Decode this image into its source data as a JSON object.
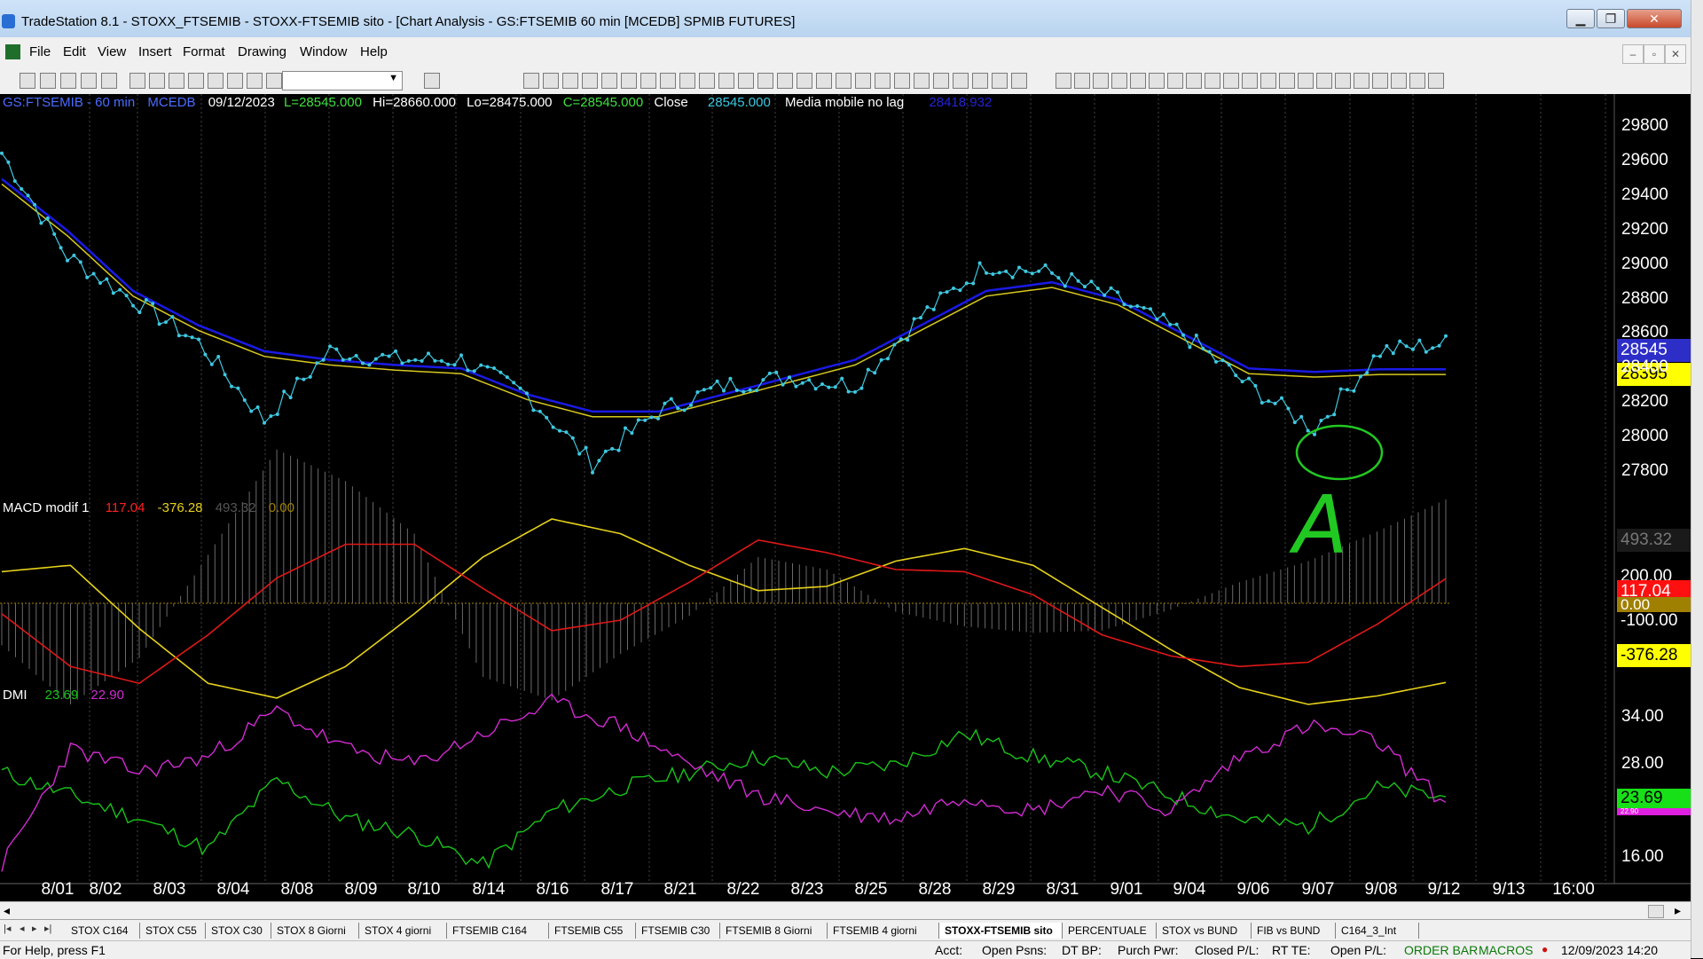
{
  "window": {
    "title": "TradeStation 8.1 - STOXX_FTSEMIB - STOXX-FTSEMIB sito - [Chart Analysis - GS:FTSEMIB  60 min  [MCEDB] SPMIB FUTURES]",
    "min_icon": "minimize-icon",
    "max_icon": "maximize-icon",
    "close_icon": "close-icon",
    "min_glyph": "▁",
    "max_glyph": "❐",
    "close_glyph": "✕"
  },
  "menu": [
    "File",
    "Edit",
    "View",
    "Insert",
    "Format",
    "Drawing",
    "Window",
    "Help"
  ],
  "mdi": {
    "min": "–",
    "restore": "▫",
    "close": "✕"
  },
  "toolbar": {
    "combo_value": ""
  },
  "chart": {
    "symbol": "GS:FTSEMIB - 60 min",
    "source": "MCEDB",
    "date": "09/12/2023",
    "last": "L=28545.000",
    "high": "Hi=28660.000",
    "low": "Lo=28475.000",
    "close_c": "C=28545.000",
    "close_label": "Close",
    "close_value": "28545.000",
    "ma_label": "Media mobile no lag",
    "ma_value": "28418.932",
    "price_tag_last": "28545",
    "price_tag_ma": "28395",
    "annotation_letter": "A",
    "macd": {
      "name": "MACD modif 1",
      "v1": "117.04",
      "v2": "-376.28",
      "v3": "493.32",
      "v4": "0.00",
      "tag1": "493.32",
      "tag2": "117.04",
      "tag3": "0.00",
      "tag4": "-376.28",
      "tag5": "200.00",
      "tag6": "-100.00"
    },
    "dmi": {
      "name": "DMI",
      "v1": "23.69",
      "v2": "22.90",
      "tag1": "23.69",
      "tag2": "22.90"
    }
  },
  "colors": {
    "price_dots": "#3ec8e0",
    "ma_blue": "#1a1ae6",
    "ma_yellow": "#d6c81e",
    "macd_red": "#e01818",
    "macd_yellow": "#e6d21a",
    "dmi_green": "#18c418",
    "dmi_magenta": "#d22ad2",
    "annotation": "#22c822"
  },
  "chart_data": [
    {
      "type": "line",
      "title": "GS:FTSEMIB - 60 min",
      "x": [
        "8/01",
        "8/02",
        "8/03",
        "8/04",
        "8/08",
        "8/09",
        "8/10",
        "8/14",
        "8/16",
        "8/17",
        "8/21",
        "8/22",
        "8/23",
        "8/25",
        "8/28",
        "8/29",
        "8/31",
        "9/01",
        "9/04",
        "9/06",
        "9/07",
        "9/08",
        "9/12",
        "9/13",
        "16:00"
      ],
      "yticks": [
        27800,
        28000,
        28200,
        28400,
        28600,
        28800,
        29000,
        29200,
        29400,
        29600,
        29800
      ],
      "ylim": [
        27650,
        29900
      ],
      "series": [
        {
          "name": "Close",
          "values": [
            29650,
            29050,
            28800,
            28550,
            28100,
            28500,
            28450,
            28450,
            28250,
            27850,
            28150,
            28300,
            28350,
            28300,
            28700,
            29000,
            28950,
            28800,
            28600,
            28300,
            28050,
            28500,
            28545
          ]
        },
        {
          "name": "Media mobile no lag",
          "values": [
            29500,
            29200,
            28850,
            28650,
            28500,
            28450,
            28420,
            28400,
            28250,
            28150,
            28150,
            28250,
            28350,
            28450,
            28650,
            28850,
            28900,
            28800,
            28600,
            28400,
            28380,
            28395,
            28395
          ]
        }
      ]
    },
    {
      "type": "line",
      "title": "MACD modif 1",
      "yticks": [
        -100,
        200
      ],
      "series": [
        {
          "name": "117.04",
          "values": [
            -50,
            -300,
            -380,
            -150,
            120,
            280,
            280,
            70,
            -130,
            -80,
            100,
            300,
            240,
            160,
            150,
            40,
            -150,
            -250,
            -300,
            -280,
            -100,
            117
          ]
        },
        {
          "name": "-376.28",
          "values": [
            150,
            180,
            -120,
            -380,
            -450,
            -300,
            -50,
            220,
            400,
            330,
            180,
            60,
            80,
            200,
            260,
            180,
            -20,
            -220,
            -400,
            -480,
            -440,
            -376
          ]
        },
        {
          "name": "493.32",
          "values": [
            -200,
            -480,
            -260,
            230,
            730,
            580,
            330,
            -350,
            -460,
            -240,
            -60,
            220,
            160,
            -40,
            -110,
            -140,
            -130,
            -30,
            100,
            200,
            340,
            493
          ]
        }
      ]
    },
    {
      "type": "line",
      "title": "DMI",
      "yticks": [
        16,
        22,
        28,
        34
      ],
      "series": [
        {
          "name": "23.69",
          "values": [
            27,
            24,
            21,
            17,
            26,
            21,
            19,
            15,
            22,
            25,
            27,
            29,
            27,
            28,
            32,
            29,
            27,
            24,
            21,
            20,
            25,
            23.69
          ]
        },
        {
          "name": "22.90",
          "values": [
            15,
            30,
            27,
            29,
            35,
            30,
            28,
            32,
            36,
            33,
            28,
            24,
            22,
            21,
            24,
            22,
            25,
            22,
            29,
            33,
            31,
            22.9
          ]
        }
      ]
    }
  ],
  "tabs": [
    "STOX C164",
    "STOX C55",
    "STOX  C30",
    "STOX  8 Giorni",
    "STOX 4 giorni",
    "FTSEMIB C164",
    "FTSEMIB C55",
    "FTSEMIB C30",
    "FTSEMIB  8 Giorni",
    "FTSEMIB  4 giorni",
    "STOXX-FTSEMIB sito",
    "PERCENTUALE",
    "STOX vs BUND",
    "FIB vs BUND",
    "C164_3_Int"
  ],
  "status": {
    "help": "For Help, press F1",
    "acct": "Acct:",
    "open_psns": "Open Psns:",
    "dt_bp": "DT BP:",
    "purch_pwr": "Purch Pwr:",
    "closed_pl": "Closed P/L:",
    "rt_te": "RT TE:",
    "open_pl": "Open P/L:",
    "order_bar": "ORDER BAR",
    "macros": "MACROS",
    "datetime": "12/09/2023 14:20"
  }
}
